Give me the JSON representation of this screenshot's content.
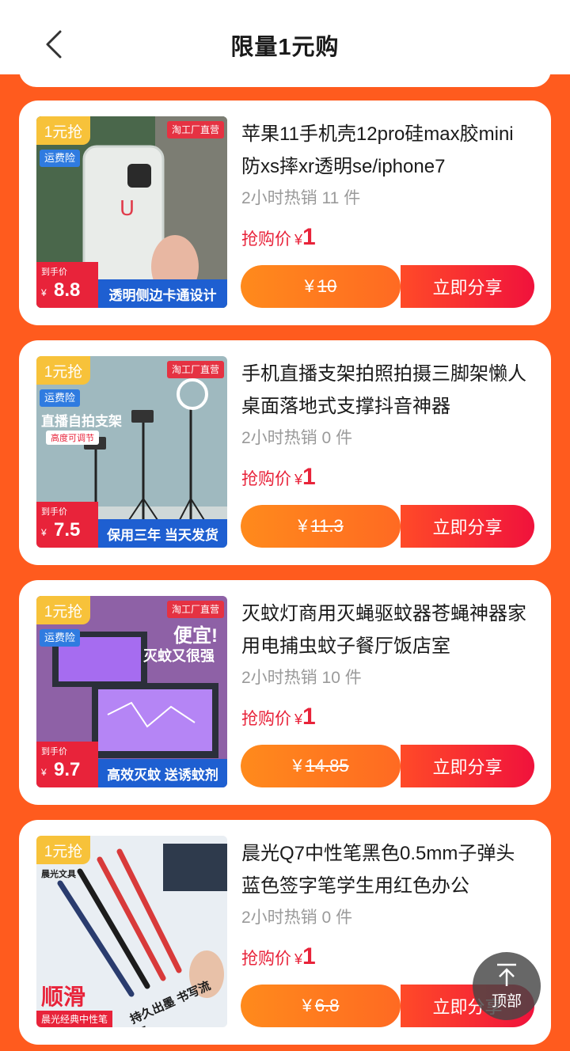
{
  "header": {
    "title": "限量1元购"
  },
  "common": {
    "tag_label": "1元抢",
    "freight_label": "运费险",
    "brand_label": "淘工厂直营",
    "arrive_label": "到手价",
    "currency": "¥",
    "deal_label": "抢购价",
    "deal_price": "1",
    "share_label": "立即分享",
    "sales_prefix": "2小时热销",
    "sales_unit": "件"
  },
  "products": [
    {
      "title": "苹果11手机壳12pro硅max胶mini防xs摔xr透明se/iphone7",
      "sales_count": "11",
      "original_price": "10",
      "img_price": "8.8",
      "img_banner": "透明侧边卡通设计"
    },
    {
      "title": "手机直播支架拍照拍摄三脚架懒人桌面落地式支撑抖音神器",
      "sales_count": "0",
      "original_price": "11.3",
      "img_price": "7.5",
      "img_banner": "保用三年 当天发货",
      "img_caption": "直播自拍支架",
      "img_sub": "高度可调节"
    },
    {
      "title": "灭蚊灯商用灭蝇驱蚊器苍蝇神器家用电捕虫蚊子餐厅饭店室",
      "sales_count": "10",
      "original_price": "14.85",
      "img_price": "9.7",
      "img_banner": "高效灭蚊 送诱蚊剂",
      "img_caption": "便宜!",
      "img_sub": "灭蚊又很强"
    },
    {
      "title": "晨光Q7中性笔黑色0.5mm子弹头蓝色签字笔学生用红色办公",
      "sales_count": "0",
      "original_price": "6.8",
      "img_caption": "顺滑",
      "img_sub": "晨光经典中性笔",
      "img_slogan": "持久出墨 书写流畅",
      "img_brand": "晨光文具"
    }
  ],
  "back_to_top": {
    "label": "顶部"
  },
  "colors": {
    "accent": "#ff5b1e",
    "price_red": "#e8233a",
    "tag_yellow": "#f7c23a"
  }
}
